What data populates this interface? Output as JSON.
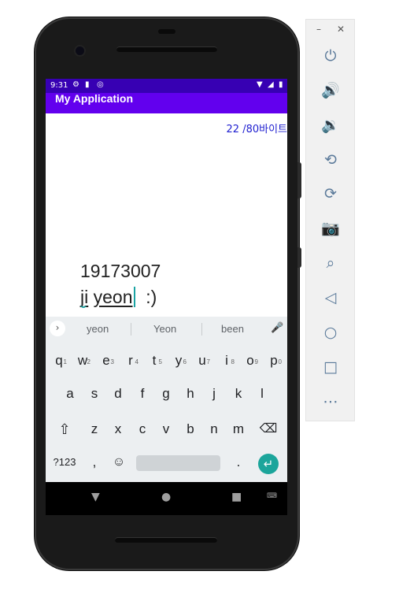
{
  "status_bar": {
    "time": "9:31"
  },
  "app_bar": {
    "title": "My Application"
  },
  "byte_counter": "22 /80바이트",
  "edit_text": {
    "line1": "19173007",
    "word1": "ji",
    "word2": "yeon",
    "tail": "  :)"
  },
  "keyboard": {
    "suggestions": [
      "yeon",
      "Yeon",
      "been"
    ],
    "row1": [
      {
        "k": "q",
        "n": "1"
      },
      {
        "k": "w",
        "n": "2"
      },
      {
        "k": "e",
        "n": "3"
      },
      {
        "k": "r",
        "n": "4"
      },
      {
        "k": "t",
        "n": "5"
      },
      {
        "k": "y",
        "n": "6"
      },
      {
        "k": "u",
        "n": "7"
      },
      {
        "k": "i",
        "n": "8"
      },
      {
        "k": "o",
        "n": "9"
      },
      {
        "k": "p",
        "n": "0"
      }
    ],
    "row2": [
      "a",
      "s",
      "d",
      "f",
      "g",
      "h",
      "j",
      "k",
      "l"
    ],
    "row3": [
      "z",
      "x",
      "c",
      "v",
      "b",
      "n",
      "m"
    ],
    "symbols_key": "?123",
    "comma_key": ",",
    "period_key": "."
  },
  "icons": {
    "status": [
      "settings-icon",
      "sd-card-icon",
      "data-saver-icon",
      "wifi-icon",
      "signal-icon",
      "battery-icon"
    ],
    "toolbar": [
      "power-icon",
      "volume-up-icon",
      "volume-down-icon",
      "rotate-left-icon",
      "rotate-right-icon",
      "camera-icon",
      "zoom-icon",
      "back-icon",
      "home-icon",
      "overview-icon",
      "more-icon"
    ]
  },
  "colors": {
    "status_bar": "#3700b3",
    "app_bar": "#6200ee",
    "accent": "#1ca59b",
    "counter_text": "#2020d0"
  }
}
